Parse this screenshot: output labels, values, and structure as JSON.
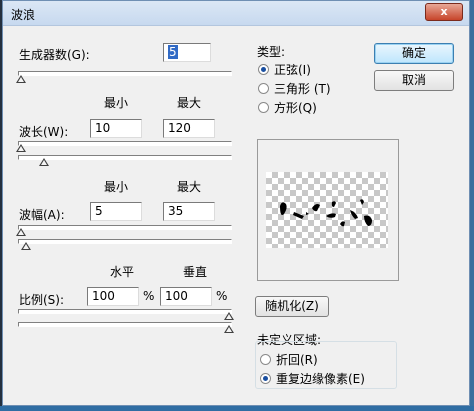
{
  "window": {
    "title": "波浪",
    "close_symbol": "x"
  },
  "generators": {
    "label": "生成器数(G):",
    "value": "5",
    "slider_fraction": 0.0
  },
  "wavelength": {
    "label": "波长(W):",
    "min_header": "最小",
    "max_header": "最大",
    "min": "10",
    "max": "120"
  },
  "amplitude": {
    "label": "波幅(A):",
    "min_header": "最小",
    "max_header": "最大",
    "min": "5",
    "max": "35"
  },
  "scale": {
    "label": "比例(S):",
    "h_header": "水平",
    "v_header": "垂直",
    "h": "100",
    "v": "100",
    "unit": "%"
  },
  "type_group": {
    "title": "类型:",
    "options": [
      "正弦(I)",
      "三角形 (T)",
      "方形(Q)"
    ],
    "selected": 0
  },
  "buttons": {
    "ok": "确定",
    "cancel": "取消",
    "randomize": "随机化(Z)"
  },
  "undefined_area": {
    "title": "未定义区域:",
    "options": [
      "折回(R)",
      "重复边缘像素(E)"
    ],
    "selected": 1
  },
  "colors": {
    "accent": "#316ac5",
    "titlebar": "#c7d9ef",
    "close": "#c7442a"
  }
}
